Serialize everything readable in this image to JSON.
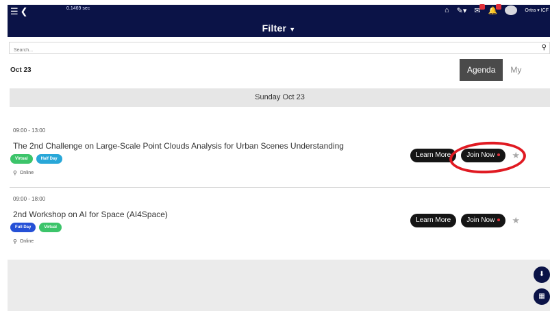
{
  "topbar": {
    "time": "0.1469 sec",
    "filter_label": "Filter",
    "user_name": "Ortra",
    "org": "ICF"
  },
  "search": {
    "placeholder": "Search..."
  },
  "date_label": "Oct 23",
  "tabs": [
    {
      "label": "Agenda",
      "active": true
    },
    {
      "label": "My Agenda",
      "active": false
    }
  ],
  "day_header": "Sunday Oct 23",
  "sessions": [
    {
      "time": "09:00 - 13:00",
      "title": "The 2nd Challenge on Large-Scale Point Clouds Analysis for Urban Scenes Understanding",
      "tags": [
        "Virtual",
        "Half Day"
      ],
      "location": "Online",
      "learn_more": "Learn More",
      "join_now": "Join Now"
    },
    {
      "time": "09:00 - 18:00",
      "title": "2nd Workshop on AI for Space (AI4Space)",
      "tags": [
        "Full Day",
        "Virtual"
      ],
      "location": "Online",
      "learn_more": "Learn More",
      "join_now": "Join Now"
    }
  ],
  "colors": {
    "header": "#0b1347",
    "tag_green": "#3cc46a",
    "tag_blue": "#28a7d8",
    "tag_navy": "#2550d6",
    "annotation": "#e01a22"
  }
}
